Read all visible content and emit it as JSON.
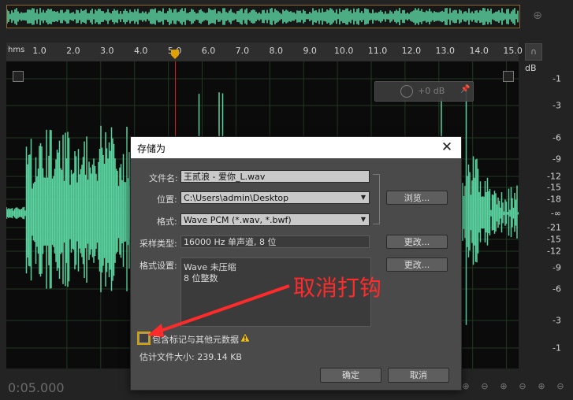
{
  "ruler": {
    "unit": "hms",
    "ticks": [
      "1.0",
      "2.0",
      "3.0",
      "4.0",
      "5.0",
      "6.0",
      "7.0",
      "8.0",
      "9.0",
      "10.0",
      "11.0",
      "12.0",
      "13.0",
      "14.0",
      "15.0"
    ]
  },
  "db_scale": {
    "unit": "dB",
    "labels": [
      "-1",
      "-3",
      "-6",
      "-9",
      "-12",
      "-15",
      "-18",
      "-∞",
      "-21",
      "-15",
      "-12",
      "-9",
      "-6",
      "-3",
      "-1"
    ]
  },
  "volume_widget": {
    "value": "+0 dB"
  },
  "time_display": "0:05.000",
  "dialog": {
    "title": "存储为",
    "filename_label": "文件名:",
    "filename_value": "王贰浪 - 爱你_L.wav",
    "location_label": "位置:",
    "location_value": "C:\\Users\\admin\\Desktop",
    "browse_button": "浏览...",
    "format_label": "格式:",
    "format_value": "Wave PCM (*.wav, *.bwf)",
    "sample_type_label": "采样类型:",
    "sample_type_value": "16000 Hz 单声道, 8 位",
    "change_button_1": "更改...",
    "format_settings_label": "格式设置:",
    "format_settings_lines": [
      "Wave 未压缩",
      "8 位整数"
    ],
    "change_button_2": "更改...",
    "include_metadata_label": "包含标记与其他元数据",
    "include_metadata_checked": false,
    "estimated_size": "估计文件大小: 239.14 KB",
    "ok_button": "确定",
    "cancel_button": "取消"
  },
  "annotation": {
    "text": "取消打钩",
    "color": "#ff2b2b"
  },
  "colors": {
    "waveform": "#5ad3a0",
    "background": "#232323",
    "overview_border": "#8a6a2c",
    "playhead": "#e0a000"
  }
}
